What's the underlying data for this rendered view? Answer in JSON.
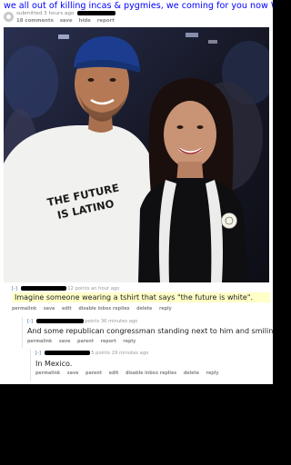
{
  "post": {
    "title": "we all out of killing incas & pygmies, we coming for you now White boi",
    "submitted_prefix": "submitted 3 hours ago",
    "actions": [
      "18 comments",
      "save",
      "hide",
      "report"
    ]
  },
  "photo": {
    "shirt_line1": "THE FUTURE",
    "shirt_line2": "IS LATINO"
  },
  "comments": [
    {
      "toggle": "[-]",
      "meta": "12 points an hour ago",
      "text": "Imagine someone wearing a tshirt that says \"the future is white\".",
      "links": [
        "permalink",
        "save",
        "edit",
        "disable inbox replies",
        "delete",
        "reply"
      ]
    },
    {
      "toggle": "[-]",
      "meta": "points 36 minutes ago",
      "text": "And some republican congressman standing next to him and smiling.",
      "links": [
        "permalink",
        "save",
        "parent",
        "report",
        "reply"
      ]
    },
    {
      "toggle": "[-]",
      "meta": "5 points 29 minutes ago",
      "text": "In Mexico.",
      "links": [
        "permalink",
        "save",
        "parent",
        "edit",
        "disable inbox replies",
        "delete",
        "reply"
      ]
    }
  ]
}
